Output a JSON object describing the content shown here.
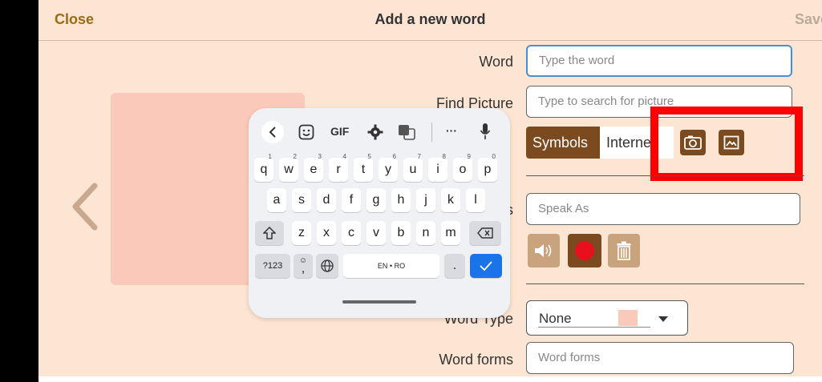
{
  "header": {
    "close_label": "Close",
    "title": "Add a new word",
    "save_label": "Save"
  },
  "form": {
    "word_label": "Word",
    "word_placeholder": "Type the word",
    "find_picture_label": "Find Picture",
    "find_picture_placeholder": "Type to search for picture",
    "source_tabs": [
      "Symbols",
      "Internet"
    ],
    "speak_as_label_partial": "s",
    "speak_as_placeholder": "Speak As",
    "word_type_label": "Word Type",
    "word_type_value": "None",
    "word_forms_label": "Word forms",
    "word_forms_placeholder": "Word forms"
  },
  "keyboard": {
    "toolbar": [
      "back",
      "sticker",
      "GIF",
      "settings",
      "translate",
      "more",
      "mic"
    ],
    "gif_label": "GIF",
    "more_label": "···",
    "row1": [
      "q",
      "w",
      "e",
      "r",
      "t",
      "y",
      "u",
      "i",
      "o",
      "p"
    ],
    "row1_digits": [
      "1",
      "2",
      "3",
      "4",
      "5",
      "6",
      "7",
      "8",
      "9",
      "0"
    ],
    "row2": [
      "a",
      "s",
      "d",
      "f",
      "g",
      "h",
      "j",
      "k",
      "l"
    ],
    "row3": [
      "z",
      "x",
      "c",
      "v",
      "b",
      "n",
      "m"
    ],
    "numbers_key": "?123",
    "comma_key": ",",
    "space_label": "EN • RO",
    "period_key": "."
  },
  "colors": {
    "accent": "#7b4a1e",
    "background": "#fde5d3",
    "highlight": "#ff0000",
    "focus": "#4a8fd6",
    "enter": "#1a73e8"
  }
}
